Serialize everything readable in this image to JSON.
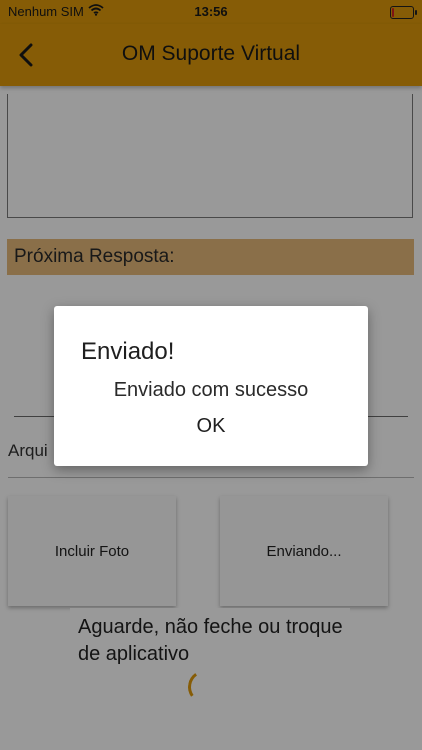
{
  "status": {
    "carrier": "Nenhum SIM",
    "time": "13:56",
    "battery_level": 0.1,
    "battery_color": "#d62020"
  },
  "header": {
    "title": "OM Suporte Virtual",
    "back_icon": "chevron-left-icon",
    "color": "#e09a0a"
  },
  "form": {
    "next_response_label": "Próxima Resposta:",
    "file_label": "Arqui",
    "include_photo_label": "Incluir Foto",
    "sending_label": "Enviando..."
  },
  "loading": {
    "message": "Aguarde, não feche ou troque de aplicativo"
  },
  "dialog": {
    "title": "Enviado!",
    "message": "Enviado com sucesso",
    "ok_label": "OK"
  }
}
